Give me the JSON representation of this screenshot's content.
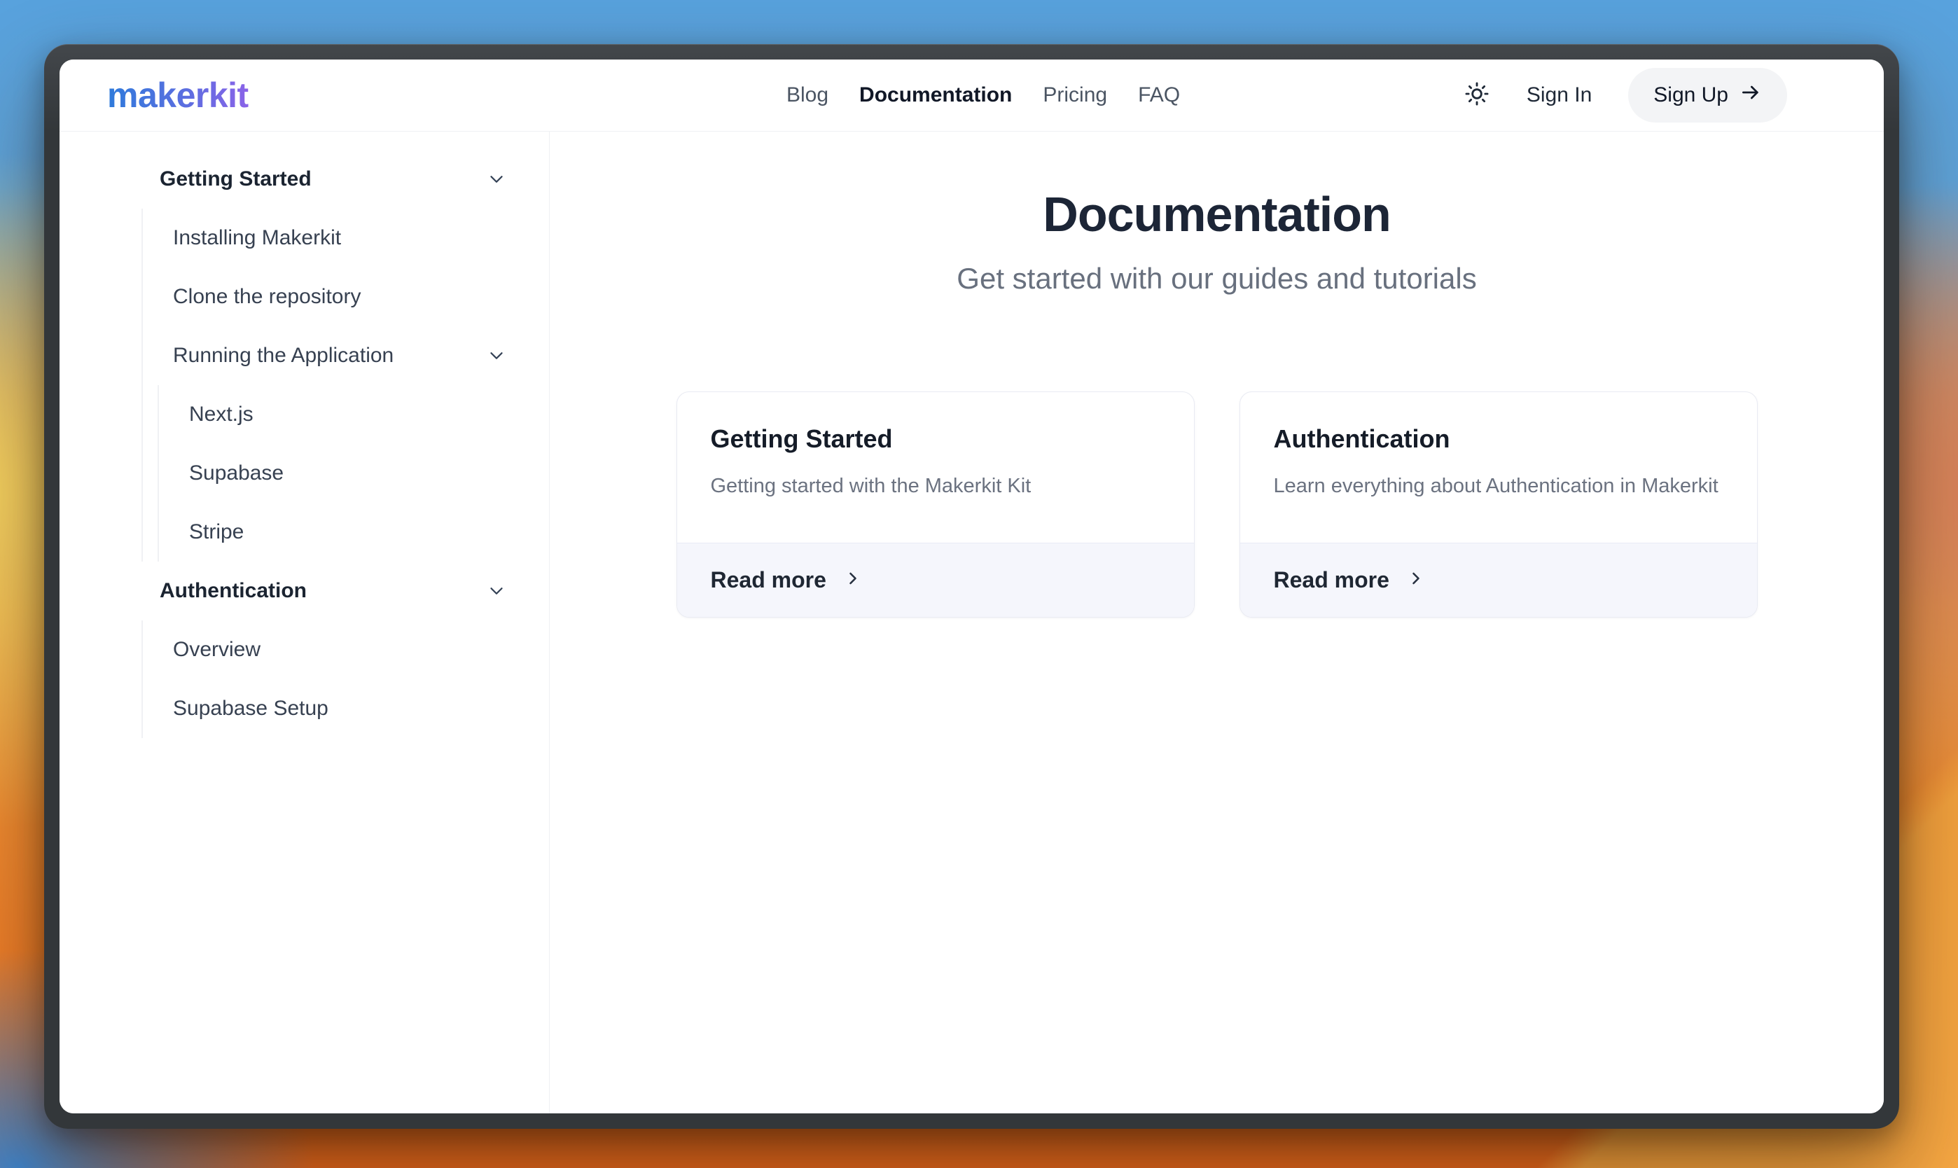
{
  "header": {
    "logo": "makerkit",
    "nav": [
      {
        "label": "Blog",
        "active": false
      },
      {
        "label": "Documentation",
        "active": true
      },
      {
        "label": "Pricing",
        "active": false
      },
      {
        "label": "FAQ",
        "active": false
      }
    ],
    "actions": {
      "theme_icon": "sun-icon",
      "sign_in": "Sign In",
      "sign_up": "Sign Up"
    }
  },
  "sidebar": {
    "sections": [
      {
        "label": "Getting Started",
        "expanded": true,
        "items": [
          {
            "label": "Installing Makerkit"
          },
          {
            "label": "Clone the repository"
          },
          {
            "label": "Running the Application",
            "expanded": true,
            "children": [
              {
                "label": "Next.js"
              },
              {
                "label": "Supabase"
              },
              {
                "label": "Stripe"
              }
            ]
          }
        ]
      },
      {
        "label": "Authentication",
        "expanded": true,
        "items": [
          {
            "label": "Overview"
          },
          {
            "label": "Supabase Setup"
          }
        ]
      }
    ]
  },
  "main": {
    "title": "Documentation",
    "subtitle": "Get started with our guides and tutorials",
    "cards": [
      {
        "title": "Getting Started",
        "description": "Getting started with the Makerkit Kit",
        "cta": "Read more"
      },
      {
        "title": "Authentication",
        "description": "Learn everything about Authentication in Makerkit",
        "cta": "Read more"
      }
    ]
  },
  "colors": {
    "logo_gradient_start": "#2f7bdb",
    "logo_gradient_end": "#8a63e8",
    "card_footer_bg": "#f5f6fc",
    "window_frame": "#33373a",
    "text_dark": "#1c2536",
    "text_muted": "#6b7280"
  }
}
